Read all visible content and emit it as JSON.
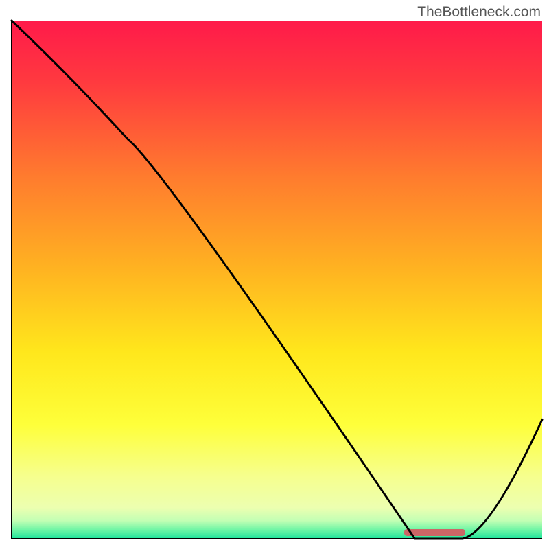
{
  "watermark": "TheBottleneck.com",
  "chart_data": {
    "type": "line",
    "title": "",
    "xlabel": "",
    "ylabel": "",
    "xlim": [
      0,
      100
    ],
    "ylim": [
      0,
      100
    ],
    "x": [
      0,
      22,
      76,
      85,
      100
    ],
    "values": [
      100,
      77,
      0,
      0,
      23
    ],
    "curve_note": "Bottleneck-percentage style curve: starts at max, descends, reaches minimum plateau around x≈76–85, then rises again.",
    "plateau_marker": {
      "x_start": 74,
      "x_end": 85.5,
      "y": 1.2,
      "color": "#cc6666"
    },
    "gradient_stops": [
      {
        "offset": 0.0,
        "color": "#ff1a4a"
      },
      {
        "offset": 0.12,
        "color": "#ff3a3f"
      },
      {
        "offset": 0.3,
        "color": "#ff7b2e"
      },
      {
        "offset": 0.48,
        "color": "#ffb321"
      },
      {
        "offset": 0.64,
        "color": "#ffe71c"
      },
      {
        "offset": 0.78,
        "color": "#feff3a"
      },
      {
        "offset": 0.88,
        "color": "#f6ff8e"
      },
      {
        "offset": 0.94,
        "color": "#ecffb0"
      },
      {
        "offset": 0.965,
        "color": "#c3ffb4"
      },
      {
        "offset": 0.985,
        "color": "#64f4a4"
      },
      {
        "offset": 1.0,
        "color": "#1de39b"
      }
    ],
    "axes": false,
    "grid": false
  }
}
